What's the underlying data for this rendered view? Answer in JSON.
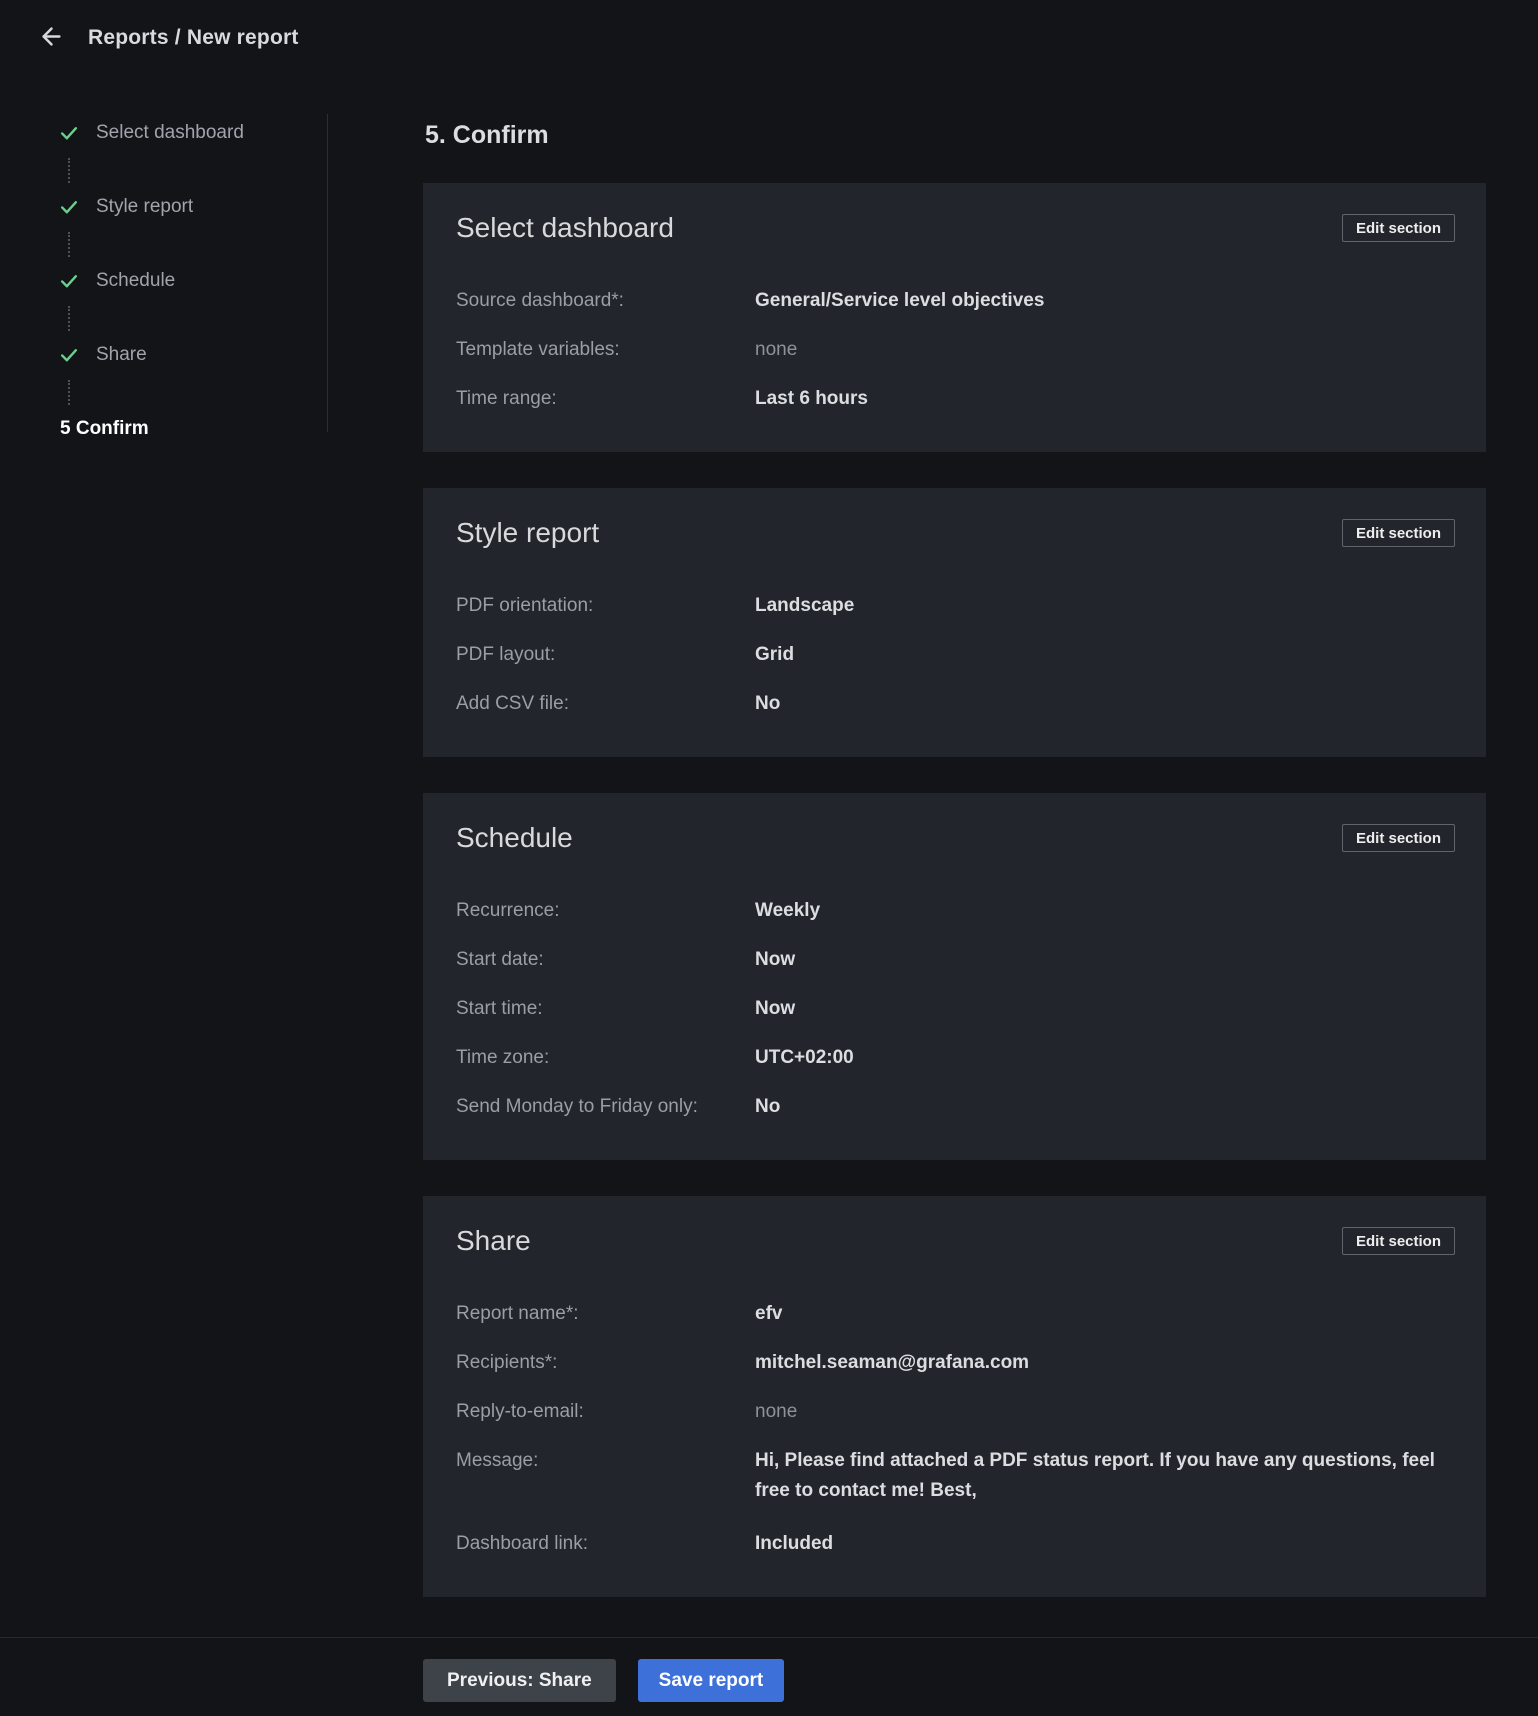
{
  "header": {
    "breadcrumb": "Reports / New report"
  },
  "stepper": {
    "completed_steps": [
      {
        "label": "Select dashboard"
      },
      {
        "label": "Style report"
      },
      {
        "label": "Schedule"
      },
      {
        "label": "Share"
      }
    ],
    "active_step_label": "5 Confirm"
  },
  "main": {
    "heading": "5. Confirm",
    "edit_button_label": "Edit section",
    "sections": [
      {
        "title": "Select dashboard",
        "rows": [
          {
            "label": "Source dashboard*:",
            "value": "General/Service level objectives"
          },
          {
            "label": "Template variables:",
            "value": "none",
            "muted": true
          },
          {
            "label": "Time range:",
            "value": "Last 6 hours"
          }
        ]
      },
      {
        "title": "Style report",
        "rows": [
          {
            "label": "PDF orientation:",
            "value": "Landscape"
          },
          {
            "label": "PDF layout:",
            "value": "Grid"
          },
          {
            "label": "Add CSV file:",
            "value": "No"
          }
        ]
      },
      {
        "title": "Schedule",
        "rows": [
          {
            "label": "Recurrence:",
            "value": "Weekly"
          },
          {
            "label": "Start date:",
            "value": "Now"
          },
          {
            "label": "Start time:",
            "value": "Now"
          },
          {
            "label": "Time zone:",
            "value": "UTC+02:00"
          },
          {
            "label": "Send Monday to Friday only:",
            "value": "No"
          }
        ]
      },
      {
        "title": "Share",
        "rows": [
          {
            "label": "Report name*:",
            "value": "efv"
          },
          {
            "label": "Recipients*:",
            "value": "mitchel.seaman@grafana.com"
          },
          {
            "label": "Reply-to-email:",
            "value": "none",
            "muted": true
          },
          {
            "label": "Message:",
            "value": "Hi, Please find attached a PDF status report. If you have any questions, feel free to contact me! Best,",
            "multiline": true
          },
          {
            "label": "Dashboard link:",
            "value": "Included"
          }
        ]
      }
    ]
  },
  "footer": {
    "previous_label": "Previous: Share",
    "save_label": "Save report"
  },
  "colors": {
    "page_bg": "#121418",
    "card_bg": "#22252B",
    "accent_blue": "#3D71D9",
    "success_green": "#6CCF8E"
  }
}
